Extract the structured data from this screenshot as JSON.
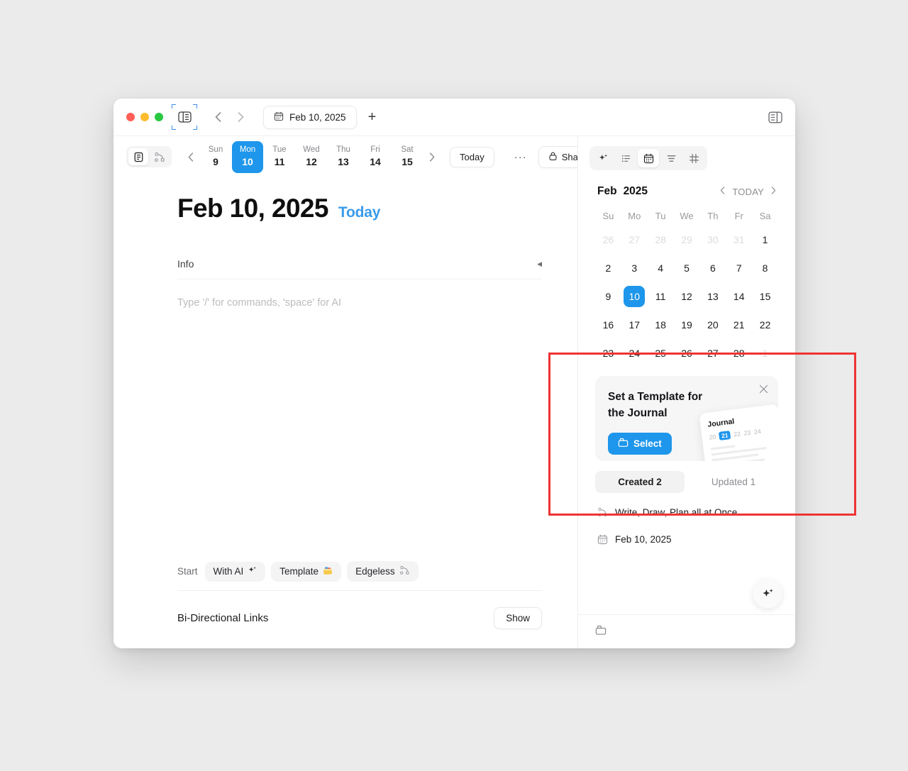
{
  "window": {
    "traffic_lights": [
      "close",
      "minimize",
      "maximize"
    ],
    "sidebar_toggle_icon": "sidebar-left-icon",
    "right_sidebar_toggle_icon": "sidebar-right-icon",
    "back_icon": "chevron-left-icon",
    "forward_icon": "chevron-right-icon",
    "tab": {
      "label": "Feb 10, 2025",
      "icon": "calendar-icon"
    },
    "new_tab_label": "+"
  },
  "main_toolbar": {
    "mode_page_icon": "page-mode-icon",
    "mode_edgeless_icon": "edgeless-mode-icon",
    "prev_week_icon": "chevron-left-icon",
    "next_week_icon": "chevron-right-icon",
    "days": [
      {
        "dow": "Sun",
        "num": "9",
        "active": false
      },
      {
        "dow": "Mon",
        "num": "10",
        "active": true
      },
      {
        "dow": "Tue",
        "num": "11",
        "active": false
      },
      {
        "dow": "Wed",
        "num": "12",
        "active": false
      },
      {
        "dow": "Thu",
        "num": "13",
        "active": false
      },
      {
        "dow": "Fri",
        "num": "14",
        "active": false
      },
      {
        "dow": "Sat",
        "num": "15",
        "active": false
      }
    ],
    "today_label": "Today",
    "more_label": "···",
    "share_label": "Share",
    "share_icon": "lock-icon"
  },
  "document": {
    "title": "Feb 10, 2025",
    "today_tag": "Today",
    "info_label": "Info",
    "info_collapse_icon": "caret-left-icon",
    "editor_placeholder": "Type '/' for commands, 'space' for AI",
    "start_label": "Start",
    "start_chips": [
      {
        "label": "With AI",
        "icon": "ai-sparkle-icon"
      },
      {
        "label": "Template",
        "icon": "template-icon"
      },
      {
        "label": "Edgeless",
        "icon": "edgeless-mode-icon"
      }
    ],
    "bidirectional_label": "Bi-Directional Links",
    "show_label": "Show"
  },
  "right_panel": {
    "toolbar_icons": [
      {
        "name": "ai-sparkle-icon",
        "active": false
      },
      {
        "name": "list-icon",
        "active": false
      },
      {
        "name": "calendar-icon",
        "active": true
      },
      {
        "name": "outline-icon",
        "active": false
      },
      {
        "name": "frame-icon",
        "active": false
      }
    ],
    "calendar": {
      "month": "Feb",
      "year": "2025",
      "prev_icon": "chevron-left-icon",
      "today_label": "TODAY",
      "next_icon": "chevron-right-icon",
      "weekdays": [
        "Su",
        "Mo",
        "Tu",
        "We",
        "Th",
        "Fr",
        "Sa"
      ],
      "weeks": [
        [
          {
            "d": "26",
            "muted": true
          },
          {
            "d": "27",
            "muted": true
          },
          {
            "d": "28",
            "muted": true
          },
          {
            "d": "29",
            "muted": true
          },
          {
            "d": "30",
            "muted": true
          },
          {
            "d": "31",
            "muted": true
          },
          {
            "d": "1",
            "muted": false
          }
        ],
        [
          {
            "d": "2",
            "muted": false
          },
          {
            "d": "3",
            "muted": false
          },
          {
            "d": "4",
            "muted": false
          },
          {
            "d": "5",
            "muted": false
          },
          {
            "d": "6",
            "muted": false
          },
          {
            "d": "7",
            "muted": false
          },
          {
            "d": "8",
            "muted": false
          }
        ],
        [
          {
            "d": "9",
            "muted": false
          },
          {
            "d": "10",
            "muted": false,
            "selected": true
          },
          {
            "d": "11",
            "muted": false
          },
          {
            "d": "12",
            "muted": false
          },
          {
            "d": "13",
            "muted": false
          },
          {
            "d": "14",
            "muted": false
          },
          {
            "d": "15",
            "muted": false
          }
        ],
        [
          {
            "d": "16",
            "muted": false
          },
          {
            "d": "17",
            "muted": false
          },
          {
            "d": "18",
            "muted": false
          },
          {
            "d": "19",
            "muted": false
          },
          {
            "d": "20",
            "muted": false
          },
          {
            "d": "21",
            "muted": false
          },
          {
            "d": "22",
            "muted": false
          }
        ],
        [
          {
            "d": "23",
            "muted": false
          },
          {
            "d": "24",
            "muted": false
          },
          {
            "d": "25",
            "muted": false
          },
          {
            "d": "26",
            "muted": false
          },
          {
            "d": "27",
            "muted": false
          },
          {
            "d": "28",
            "muted": false
          },
          {
            "d": "1",
            "muted": true
          }
        ]
      ]
    },
    "promo": {
      "title_line1": "Set a Template for",
      "title_line2": "the Journal",
      "close_icon": "close-icon",
      "select_label": "Select",
      "select_icon": "template-icon",
      "preview": {
        "title": "Journal",
        "dates": [
          "20",
          "21",
          "22",
          "23",
          "24"
        ],
        "highlighted": "21"
      }
    },
    "tabs": [
      {
        "label": "Created 2",
        "active": true
      },
      {
        "label": "Updated 1",
        "active": false
      }
    ],
    "items": [
      {
        "icon": "edgeless-mode-icon",
        "title": "Write, Draw, Plan all at Once."
      },
      {
        "icon": "calendar-icon",
        "title": "Feb 10, 2025"
      }
    ],
    "footer_icon": "template-icon",
    "ai_fab_icon": "ai-sparkle-icon"
  },
  "annotation": {
    "color": "#ef3434",
    "shape": "rectangle"
  }
}
